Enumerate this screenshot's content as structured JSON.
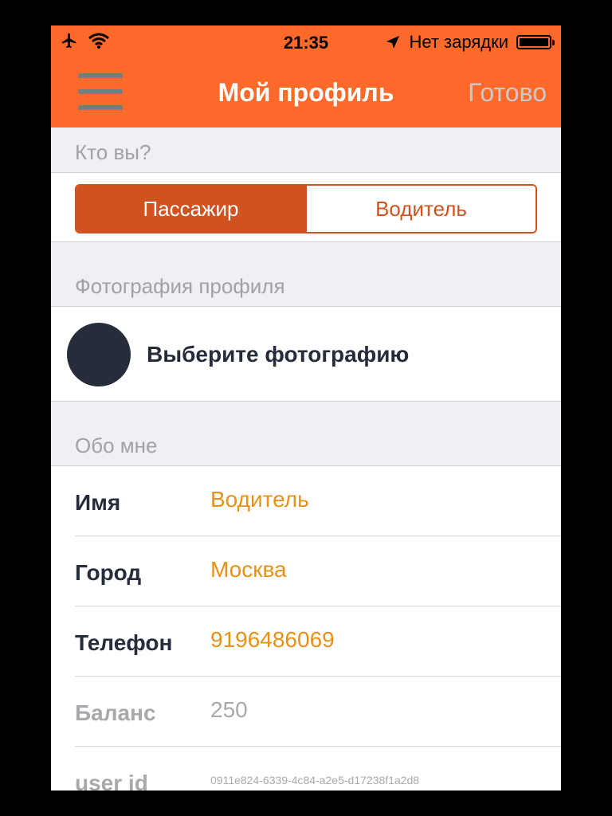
{
  "status_bar": {
    "time": "21:35",
    "carrier_text": "Нет зарядки",
    "icons": [
      "airplane-icon",
      "wifi-icon",
      "location-arrow-icon",
      "battery-icon"
    ]
  },
  "nav": {
    "title": "Мой профиль",
    "done_label": "Готово",
    "menu_icon": "menu-icon"
  },
  "who": {
    "header": "Кто вы?",
    "options": [
      "Пассажир",
      "Водитель"
    ],
    "selected": "Пассажир"
  },
  "photo": {
    "header": "Фотография профиля",
    "label": "Выберите фотографию"
  },
  "about": {
    "header": "Обо мне",
    "rows": [
      {
        "label": "Имя",
        "value": "Водитель"
      },
      {
        "label": "Город",
        "value": "Москва"
      },
      {
        "label": "Телефон",
        "value": "9196486069"
      },
      {
        "label": "Баланс",
        "value": "250"
      },
      {
        "label": "user id",
        "value": "0911e824-6339-4c84-a2e5-d17238f1a2d8"
      }
    ]
  },
  "colors": {
    "accent": "#ff6a2a",
    "segment": "#d0531f",
    "value": "#e79119",
    "dark": "#272c3a",
    "muted": "#a9a9ad"
  }
}
